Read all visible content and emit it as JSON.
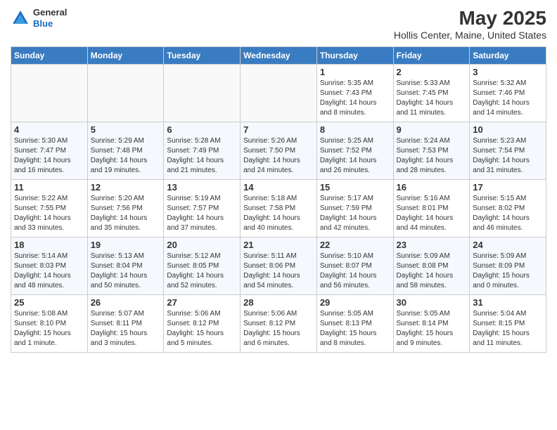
{
  "header": {
    "logo_general": "General",
    "logo_blue": "Blue",
    "month": "May 2025",
    "location": "Hollis Center, Maine, United States"
  },
  "days_of_week": [
    "Sunday",
    "Monday",
    "Tuesday",
    "Wednesday",
    "Thursday",
    "Friday",
    "Saturday"
  ],
  "weeks": [
    [
      {
        "day": "",
        "info": ""
      },
      {
        "day": "",
        "info": ""
      },
      {
        "day": "",
        "info": ""
      },
      {
        "day": "",
        "info": ""
      },
      {
        "day": "1",
        "info": "Sunrise: 5:35 AM\nSunset: 7:43 PM\nDaylight: 14 hours\nand 8 minutes."
      },
      {
        "day": "2",
        "info": "Sunrise: 5:33 AM\nSunset: 7:45 PM\nDaylight: 14 hours\nand 11 minutes."
      },
      {
        "day": "3",
        "info": "Sunrise: 5:32 AM\nSunset: 7:46 PM\nDaylight: 14 hours\nand 14 minutes."
      }
    ],
    [
      {
        "day": "4",
        "info": "Sunrise: 5:30 AM\nSunset: 7:47 PM\nDaylight: 14 hours\nand 16 minutes."
      },
      {
        "day": "5",
        "info": "Sunrise: 5:29 AM\nSunset: 7:48 PM\nDaylight: 14 hours\nand 19 minutes."
      },
      {
        "day": "6",
        "info": "Sunrise: 5:28 AM\nSunset: 7:49 PM\nDaylight: 14 hours\nand 21 minutes."
      },
      {
        "day": "7",
        "info": "Sunrise: 5:26 AM\nSunset: 7:50 PM\nDaylight: 14 hours\nand 24 minutes."
      },
      {
        "day": "8",
        "info": "Sunrise: 5:25 AM\nSunset: 7:52 PM\nDaylight: 14 hours\nand 26 minutes."
      },
      {
        "day": "9",
        "info": "Sunrise: 5:24 AM\nSunset: 7:53 PM\nDaylight: 14 hours\nand 28 minutes."
      },
      {
        "day": "10",
        "info": "Sunrise: 5:23 AM\nSunset: 7:54 PM\nDaylight: 14 hours\nand 31 minutes."
      }
    ],
    [
      {
        "day": "11",
        "info": "Sunrise: 5:22 AM\nSunset: 7:55 PM\nDaylight: 14 hours\nand 33 minutes."
      },
      {
        "day": "12",
        "info": "Sunrise: 5:20 AM\nSunset: 7:56 PM\nDaylight: 14 hours\nand 35 minutes."
      },
      {
        "day": "13",
        "info": "Sunrise: 5:19 AM\nSunset: 7:57 PM\nDaylight: 14 hours\nand 37 minutes."
      },
      {
        "day": "14",
        "info": "Sunrise: 5:18 AM\nSunset: 7:58 PM\nDaylight: 14 hours\nand 40 minutes."
      },
      {
        "day": "15",
        "info": "Sunrise: 5:17 AM\nSunset: 7:59 PM\nDaylight: 14 hours\nand 42 minutes."
      },
      {
        "day": "16",
        "info": "Sunrise: 5:16 AM\nSunset: 8:01 PM\nDaylight: 14 hours\nand 44 minutes."
      },
      {
        "day": "17",
        "info": "Sunrise: 5:15 AM\nSunset: 8:02 PM\nDaylight: 14 hours\nand 46 minutes."
      }
    ],
    [
      {
        "day": "18",
        "info": "Sunrise: 5:14 AM\nSunset: 8:03 PM\nDaylight: 14 hours\nand 48 minutes."
      },
      {
        "day": "19",
        "info": "Sunrise: 5:13 AM\nSunset: 8:04 PM\nDaylight: 14 hours\nand 50 minutes."
      },
      {
        "day": "20",
        "info": "Sunrise: 5:12 AM\nSunset: 8:05 PM\nDaylight: 14 hours\nand 52 minutes."
      },
      {
        "day": "21",
        "info": "Sunrise: 5:11 AM\nSunset: 8:06 PM\nDaylight: 14 hours\nand 54 minutes."
      },
      {
        "day": "22",
        "info": "Sunrise: 5:10 AM\nSunset: 8:07 PM\nDaylight: 14 hours\nand 56 minutes."
      },
      {
        "day": "23",
        "info": "Sunrise: 5:09 AM\nSunset: 8:08 PM\nDaylight: 14 hours\nand 58 minutes."
      },
      {
        "day": "24",
        "info": "Sunrise: 5:09 AM\nSunset: 8:09 PM\nDaylight: 15 hours\nand 0 minutes."
      }
    ],
    [
      {
        "day": "25",
        "info": "Sunrise: 5:08 AM\nSunset: 8:10 PM\nDaylight: 15 hours\nand 1 minute."
      },
      {
        "day": "26",
        "info": "Sunrise: 5:07 AM\nSunset: 8:11 PM\nDaylight: 15 hours\nand 3 minutes."
      },
      {
        "day": "27",
        "info": "Sunrise: 5:06 AM\nSunset: 8:12 PM\nDaylight: 15 hours\nand 5 minutes."
      },
      {
        "day": "28",
        "info": "Sunrise: 5:06 AM\nSunset: 8:12 PM\nDaylight: 15 hours\nand 6 minutes."
      },
      {
        "day": "29",
        "info": "Sunrise: 5:05 AM\nSunset: 8:13 PM\nDaylight: 15 hours\nand 8 minutes."
      },
      {
        "day": "30",
        "info": "Sunrise: 5:05 AM\nSunset: 8:14 PM\nDaylight: 15 hours\nand 9 minutes."
      },
      {
        "day": "31",
        "info": "Sunrise: 5:04 AM\nSunset: 8:15 PM\nDaylight: 15 hours\nand 11 minutes."
      }
    ]
  ]
}
